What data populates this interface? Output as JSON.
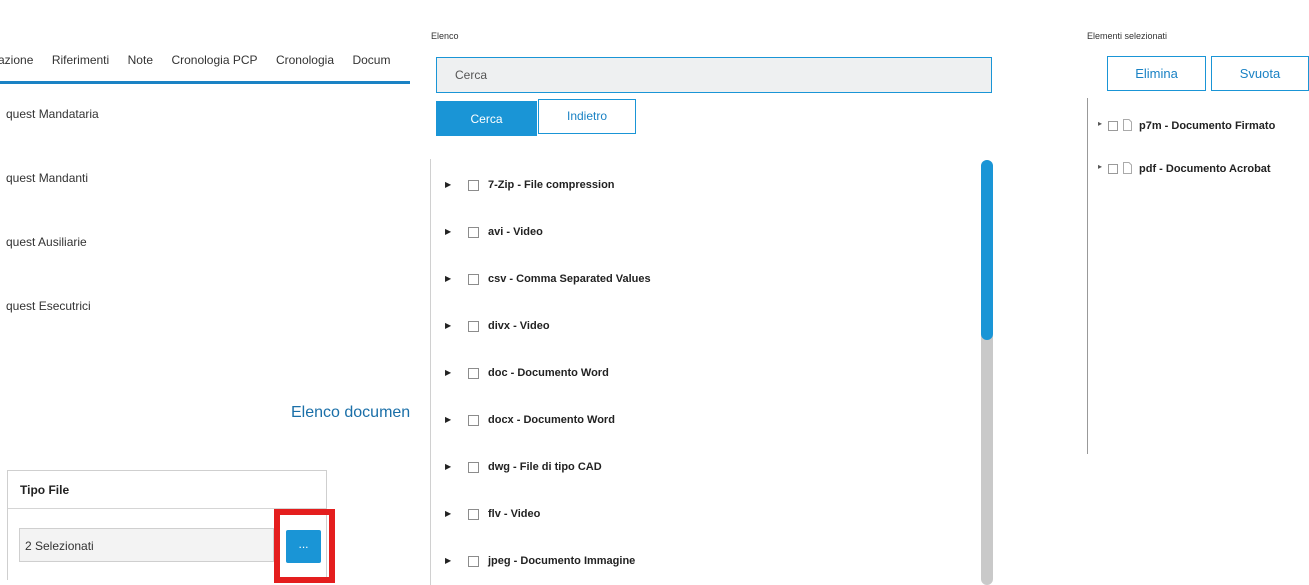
{
  "background_page": {
    "tabs": [
      "utazione",
      "Riferimenti",
      "Note",
      "Cronologia PCP",
      "Cronologia",
      "Docum"
    ],
    "rows": [
      "quest Mandataria",
      "quest Mandanti",
      "quest Ausiliarie",
      "quest Esecutrici"
    ],
    "section_title": "Elenco documen",
    "table": {
      "header": "Tipo File",
      "selected_value": "2 Selezionati",
      "browse_button": "..."
    }
  },
  "dialog": {
    "list_label": "Elenco",
    "search": {
      "placeholder": "Cerca",
      "value": "Cerca"
    },
    "search_button": "Cerca",
    "back_button": "Indietro",
    "items": [
      "7-Zip - File compression",
      "avi - Video",
      "csv - Comma Separated Values",
      "divx - Video",
      "doc - Documento Word",
      "docx - Documento Word",
      "dwg - File di tipo CAD",
      "flv - Video",
      "jpeg - Documento Immagine"
    ],
    "selected_label": "Elementi selezionati",
    "delete_button": "Elimina",
    "clear_button": "Svuota",
    "selected_items": [
      "p7m - Documento Firmato",
      "pdf - Documento Acrobat"
    ]
  },
  "colors": {
    "accent": "#1a95d6",
    "highlight_frame": "#e41e1e",
    "scroll_track": "#c9c9c9"
  },
  "icons": {
    "expand": "triangle-right-icon",
    "checkbox": "checkbox-icon",
    "file": "file-icon"
  }
}
